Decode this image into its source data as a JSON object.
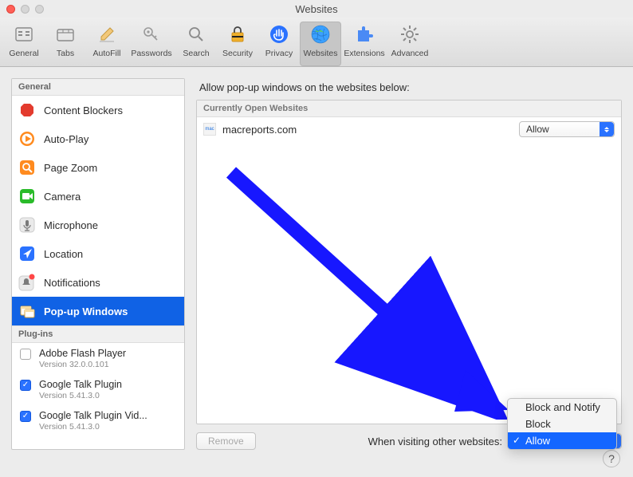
{
  "window": {
    "title": "Websites"
  },
  "toolbar": {
    "items": [
      {
        "id": "general",
        "label": "General"
      },
      {
        "id": "tabs",
        "label": "Tabs"
      },
      {
        "id": "autofill",
        "label": "AutoFill"
      },
      {
        "id": "passwords",
        "label": "Passwords"
      },
      {
        "id": "search",
        "label": "Search"
      },
      {
        "id": "security",
        "label": "Security"
      },
      {
        "id": "privacy",
        "label": "Privacy"
      },
      {
        "id": "websites",
        "label": "Websites"
      },
      {
        "id": "extensions",
        "label": "Extensions"
      },
      {
        "id": "advanced",
        "label": "Advanced"
      }
    ],
    "selected": "websites"
  },
  "sidebar": {
    "section_general": "General",
    "section_plugins": "Plug-ins",
    "items": [
      {
        "label": "Content Blockers"
      },
      {
        "label": "Auto-Play"
      },
      {
        "label": "Page Zoom"
      },
      {
        "label": "Camera"
      },
      {
        "label": "Microphone"
      },
      {
        "label": "Location"
      },
      {
        "label": "Notifications"
      },
      {
        "label": "Pop-up Windows"
      }
    ],
    "selected_index": 7,
    "plugins": [
      {
        "name": "Adobe Flash Player",
        "version": "Version 32.0.0.101",
        "enabled": false
      },
      {
        "name": "Google Talk Plugin",
        "version": "Version 5.41.3.0",
        "enabled": true
      },
      {
        "name": "Google Talk Plugin Vid...",
        "version": "Version 5.41.3.0",
        "enabled": true
      }
    ]
  },
  "main": {
    "heading": "Allow pop-up windows on the websites below:",
    "table_header": "Currently Open Websites",
    "rows": [
      {
        "site": "macreports.com",
        "value": "Allow"
      }
    ],
    "remove_label": "Remove",
    "footer_label": "When visiting other websites:",
    "dropdown": {
      "options": [
        "Block and Notify",
        "Block",
        "Allow"
      ],
      "selected": "Allow"
    }
  },
  "annotation": {
    "arrow_color": "#1717ff"
  }
}
